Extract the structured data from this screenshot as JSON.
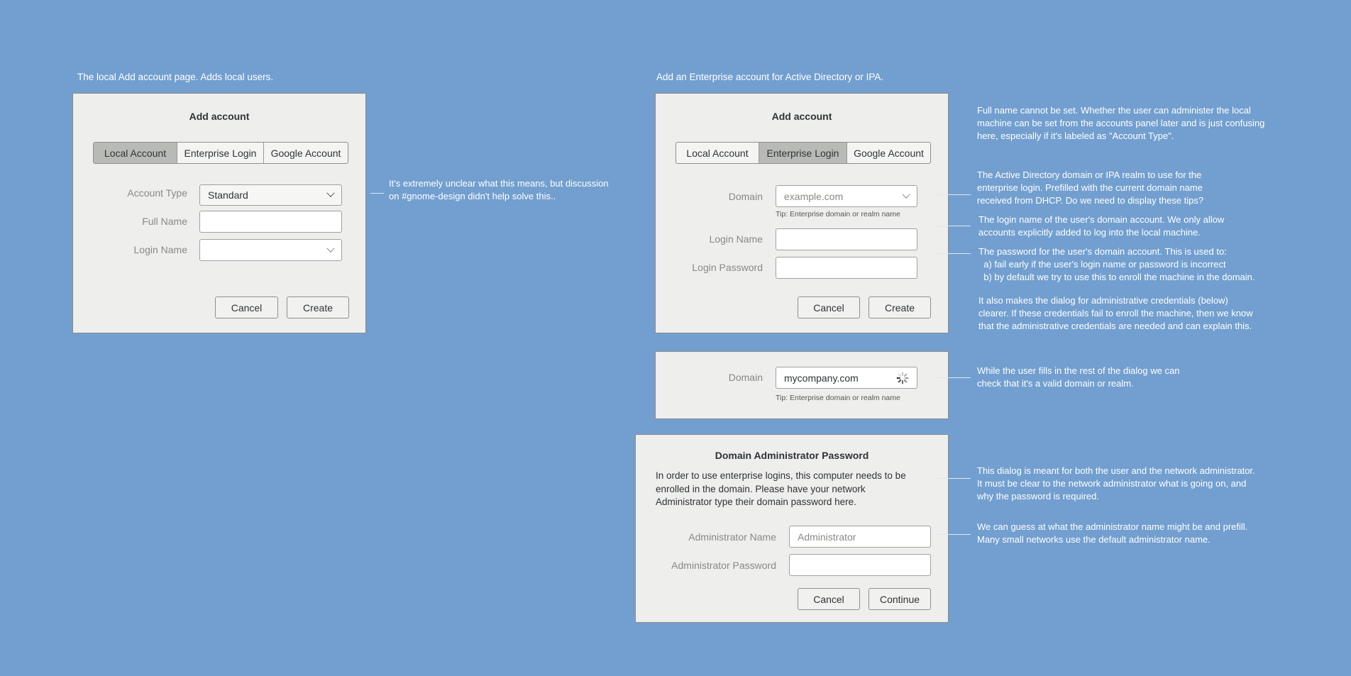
{
  "colors": {
    "background": "#729fcf",
    "dialog": "#eeeeec",
    "active_tab": "#b8bab5"
  },
  "local": {
    "caption": "The local Add account page. Adds local users.",
    "title": "Add account",
    "tabs": [
      {
        "label": "Local Account",
        "active": true
      },
      {
        "label": "Enterprise Login",
        "active": false
      },
      {
        "label": "Google Account",
        "active": false
      }
    ],
    "account_type_label": "Account Type",
    "account_type_value": "Standard",
    "full_name_label": "Full Name",
    "full_name_value": "",
    "login_name_label": "Login Name",
    "login_name_value": "",
    "cancel": "Cancel",
    "create": "Create",
    "note": "It's extremely unclear what this means, but discussion\non #gnome-design didn't help solve this.."
  },
  "enterprise": {
    "caption": "Add an Enterprise account for Active Directory or IPA.",
    "title": "Add account",
    "tabs": [
      {
        "label": "Local Account",
        "active": false
      },
      {
        "label": "Enterprise Login",
        "active": true
      },
      {
        "label": "Google Account",
        "active": false
      }
    ],
    "domain_label": "Domain",
    "domain_placeholder": "example.com",
    "domain_tip": "Tip: Enterprise domain or realm name",
    "login_name_label": "Login Name",
    "login_password_label": "Login Password",
    "cancel": "Cancel",
    "create": "Create",
    "notes": {
      "full_name": "Full name cannot be set. Whether the user can administer the local\nmachine can be set from the accounts panel later and is just confusing\nhere, especially if it's labeled as \"Account Type\".",
      "domain": "The Active Directory domain or IPA realm to use for the\nenterprise login. Prefilled with the current domain name\nreceived from DHCP. Do we need to display these tips?",
      "login_name": "The login name of the user's domain account. We only allow\naccounts explicitly added to log into the local machine.",
      "password": "The password for the user's domain account. This is used to:\n  a) fail early if the user's login name or password is incorrect\n  b) by default we try to use this to enroll the machine in the domain.",
      "also": "It also makes the dialog for administrative credentials (below)\nclearer. If these credentials fail to enroll the machine, then we know\nthat the administrative credentials are needed and can explain this."
    }
  },
  "domain_check": {
    "domain_label": "Domain",
    "domain_value": "mycompany.com",
    "domain_tip": "Tip: Enterprise domain or realm name",
    "spinner_icon": "spinner-icon",
    "note": "While the user fills in the rest of the dialog we can\ncheck that it's a valid domain or realm."
  },
  "admin": {
    "title": "Domain Administrator Password",
    "body": "In order to use enterprise logins, this computer needs to be\nenrolled in the domain. Please have your network\nAdministrator type their domain password here.",
    "admin_name_label": "Administrator Name",
    "admin_name_placeholder": "Administrator",
    "admin_password_label": "Administrator Password",
    "cancel": "Cancel",
    "continue": "Continue",
    "notes": {
      "dialog": "This dialog is meant for both the user and the network administrator.\nIt must be clear to the network administrator what is going on, and\nwhy the password is required.",
      "name": "We can guess at what the administrator name might be and prefill.\nMany small networks use the default administrator name."
    }
  }
}
